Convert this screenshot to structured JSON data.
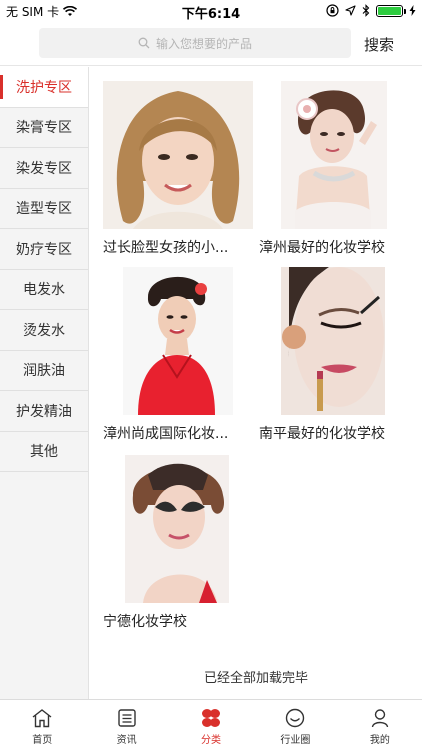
{
  "status_bar": {
    "carrier": "无 SIM 卡",
    "time": "下午6:14"
  },
  "search": {
    "placeholder": "输入您想要的产品",
    "button_label": "搜索"
  },
  "sidebar": {
    "active_color": "#d9302b",
    "items": [
      {
        "label": "洗护专区",
        "active": true
      },
      {
        "label": "染膏专区",
        "active": false
      },
      {
        "label": "染发专区",
        "active": false
      },
      {
        "label": "造型专区",
        "active": false
      },
      {
        "label": "奶疗专区",
        "active": false
      },
      {
        "label": "电发水",
        "active": false
      },
      {
        "label": "烫发水",
        "active": false
      },
      {
        "label": "润肤油",
        "active": false
      },
      {
        "label": "护发精油",
        "active": false
      },
      {
        "label": "其他",
        "active": false
      }
    ]
  },
  "products": [
    {
      "title": "过长脸型女孩的小..."
    },
    {
      "title": "漳州最好的化妆学校"
    },
    {
      "title": "漳州尚成国际化妆..."
    },
    {
      "title": "南平最好的化妆学校"
    },
    {
      "title": "宁德化妆学校"
    }
  ],
  "end_note": "已经全部加载完毕",
  "tabbar": {
    "tabs": [
      {
        "label": "首页",
        "icon": "home-icon",
        "active": false
      },
      {
        "label": "资讯",
        "icon": "news-icon",
        "active": false
      },
      {
        "label": "分类",
        "icon": "category-icon",
        "active": true
      },
      {
        "label": "行业圈",
        "icon": "circle-icon",
        "active": false
      },
      {
        "label": "我的",
        "icon": "user-icon",
        "active": false
      }
    ]
  }
}
